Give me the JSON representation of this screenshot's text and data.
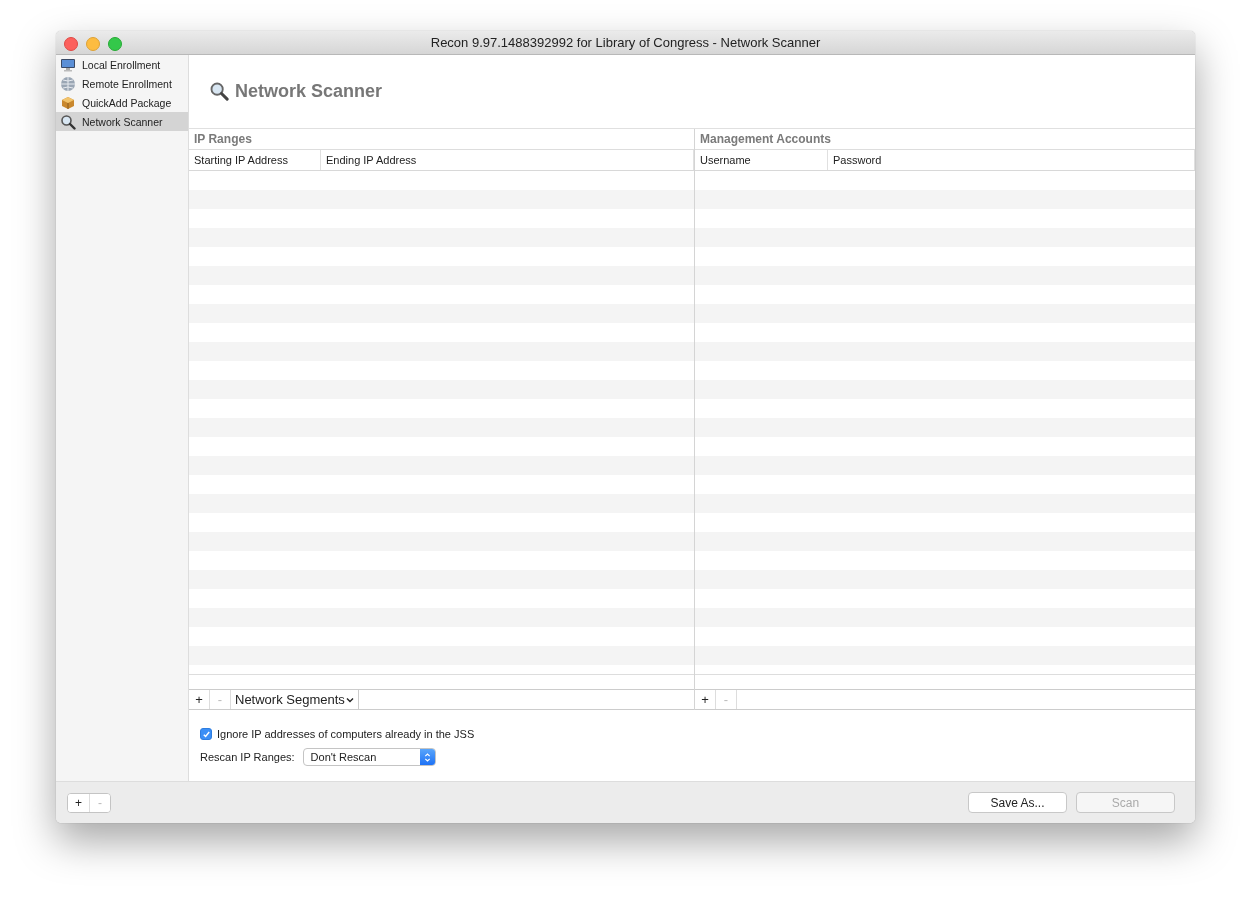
{
  "window": {
    "title": "Recon 9.97.1488392992 for Library of Congress - Network Scanner"
  },
  "sidebar": {
    "items": [
      {
        "label": "Local Enrollment",
        "kind": "monitor",
        "selected": false
      },
      {
        "label": "Remote Enrollment",
        "kind": "globe",
        "selected": false
      },
      {
        "label": "QuickAdd Package",
        "kind": "package",
        "selected": false
      },
      {
        "label": "Network Scanner",
        "kind": "magnifier",
        "selected": true
      }
    ],
    "buttons": [
      {
        "label": "+",
        "disabled": false
      },
      {
        "label": "-",
        "disabled": true
      }
    ]
  },
  "header": {
    "title": "Network Scanner"
  },
  "ip_ranges": {
    "title": "IP Ranges",
    "columns": [
      "Starting IP Address",
      "Ending IP Address"
    ],
    "buttons": [
      {
        "label": "+",
        "disabled": false
      },
      {
        "label": "-",
        "disabled": true
      }
    ],
    "menu": "Network Segments"
  },
  "management_accounts": {
    "title": "Management Accounts",
    "columns": [
      "Username",
      "Password"
    ],
    "buttons": [
      {
        "label": "+",
        "disabled": false
      },
      {
        "label": "-",
        "disabled": true
      }
    ]
  },
  "options": {
    "ignore": {
      "label": "Ignore IP addresses of computers already in the JSS",
      "checked": true
    },
    "rescan": {
      "label": "Rescan IP Ranges:",
      "value": "Don't Rescan"
    }
  },
  "footer": {
    "buttons": [
      {
        "label": "Save As...",
        "disabled": false
      },
      {
        "label": "Scan",
        "disabled": true
      }
    ]
  }
}
